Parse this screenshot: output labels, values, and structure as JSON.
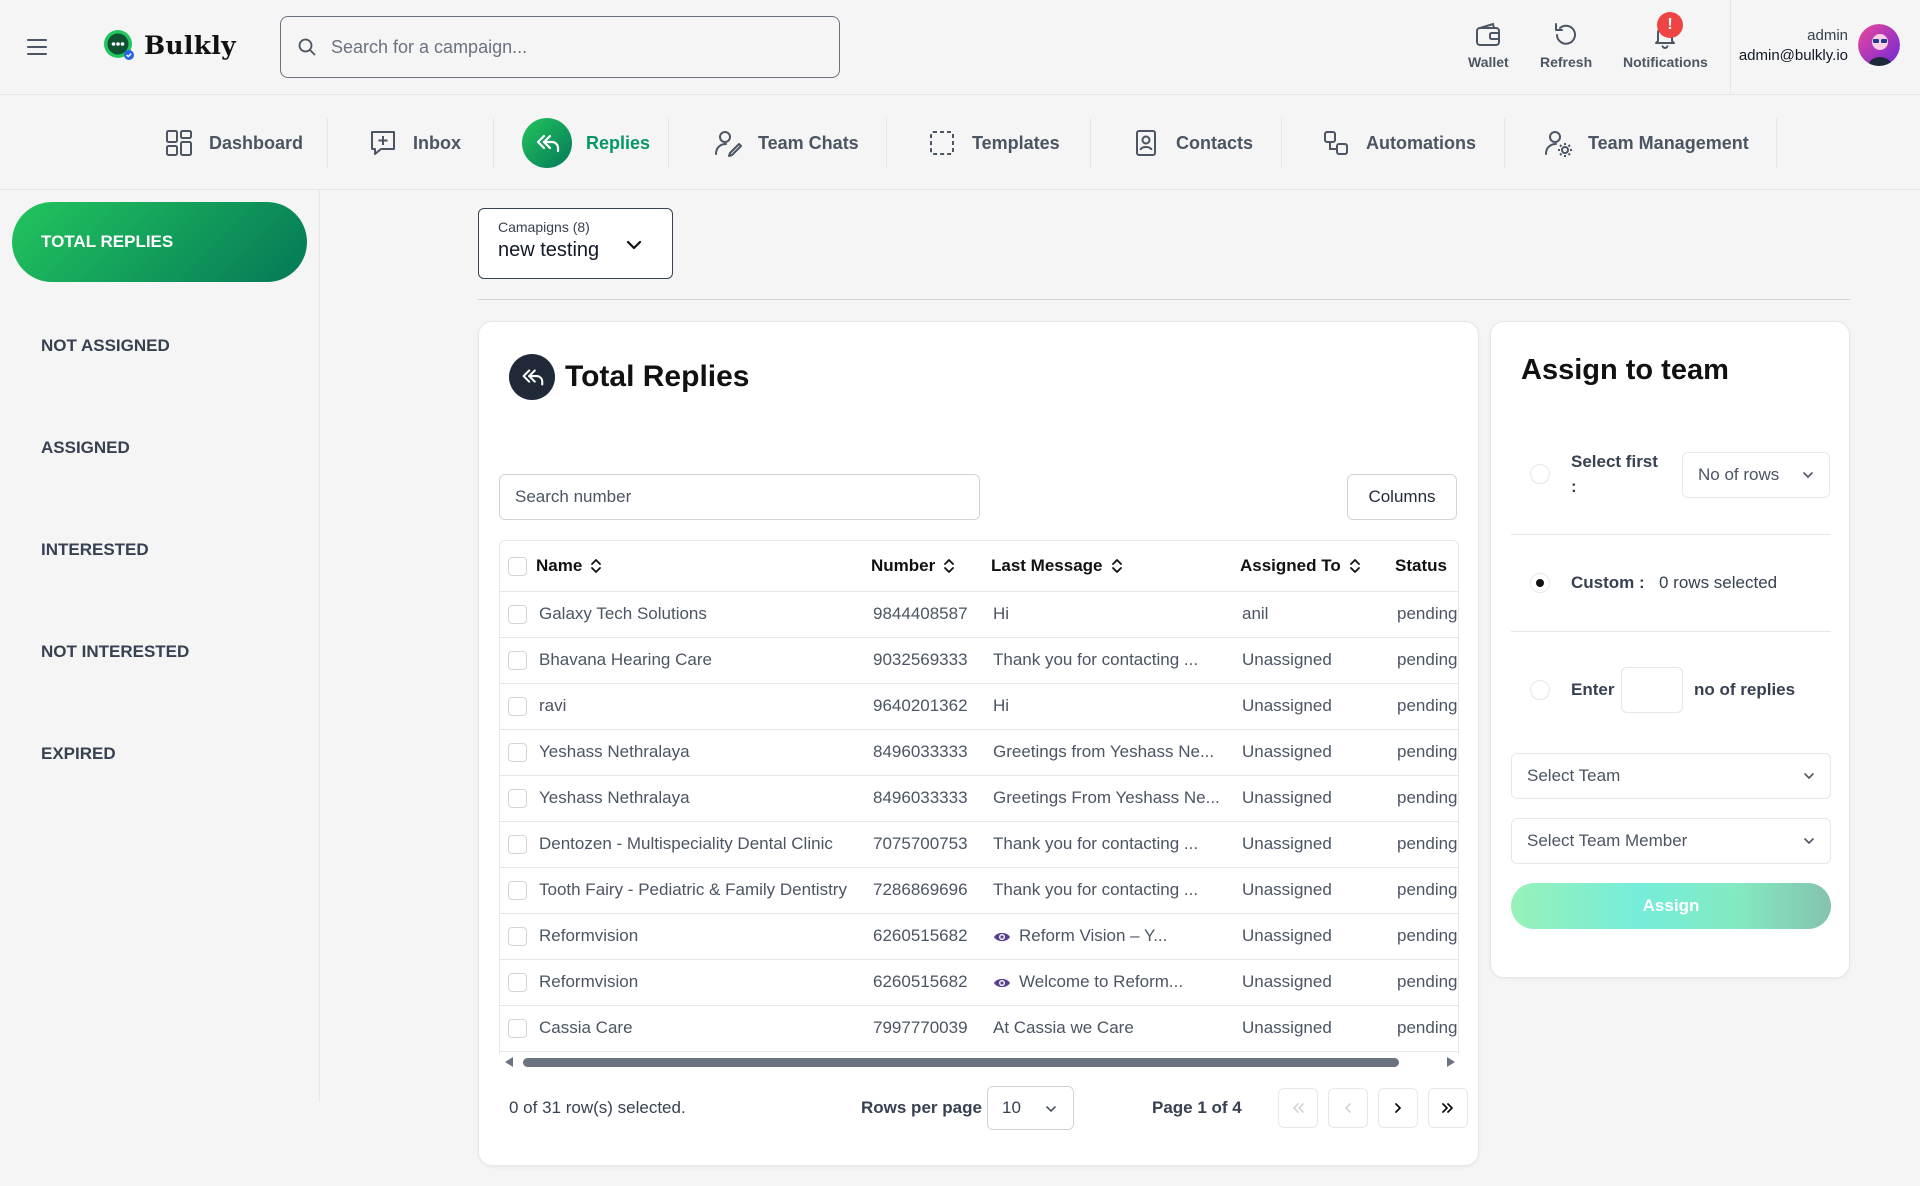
{
  "app": {
    "name": "Bulkly"
  },
  "header": {
    "search_placeholder": "Search for a campaign...",
    "wallet_label": "Wallet",
    "refresh_label": "Refresh",
    "notifications_label": "Notifications",
    "notifications_badge": "!",
    "user_name": "admin",
    "user_email": "admin@bulkly.io"
  },
  "nav": {
    "items": [
      {
        "label": "Dashboard",
        "icon": "dashboard-icon"
      },
      {
        "label": "Inbox",
        "icon": "inbox-icon"
      },
      {
        "label": "Replies",
        "icon": "replies-icon",
        "active": true
      },
      {
        "label": "Team Chats",
        "icon": "team-chats-icon"
      },
      {
        "label": "Templates",
        "icon": "templates-icon"
      },
      {
        "label": "Contacts",
        "icon": "contacts-icon"
      },
      {
        "label": "Automations",
        "icon": "automations-icon"
      },
      {
        "label": "Team Management",
        "icon": "team-management-icon"
      }
    ]
  },
  "sidebar": {
    "items": [
      {
        "label": "TOTAL REPLIES",
        "active": true
      },
      {
        "label": "NOT ASSIGNED"
      },
      {
        "label": "ASSIGNED"
      },
      {
        "label": "INTERESTED"
      },
      {
        "label": "NOT INTERESTED"
      },
      {
        "label": "EXPIRED"
      }
    ]
  },
  "campaign_select": {
    "label": "Camapigns (8)",
    "value": "new testing"
  },
  "main": {
    "title": "Total Replies",
    "search_placeholder": "Search number",
    "columns_label": "Columns",
    "table": {
      "headers": [
        "Name",
        "Number",
        "Last Message",
        "Assigned To",
        "Status"
      ],
      "rows": [
        {
          "name": "Galaxy Tech Solutions",
          "number": "9844408587",
          "message": "Hi",
          "eye": false,
          "assigned": "anil",
          "status": "pending"
        },
        {
          "name": "Bhavana Hearing Care",
          "number": "9032569333",
          "message": "Thank you for contacting ...",
          "eye": false,
          "assigned": "Unassigned",
          "status": "pending"
        },
        {
          "name": "ravi",
          "number": "9640201362",
          "message": "Hi",
          "eye": false,
          "assigned": "Unassigned",
          "status": "pending"
        },
        {
          "name": "Yeshass Nethralaya",
          "number": "8496033333",
          "message": "Greetings from Yeshass Ne...",
          "eye": false,
          "assigned": "Unassigned",
          "status": "pending"
        },
        {
          "name": "Yeshass Nethralaya",
          "number": "8496033333",
          "message": "Greetings From Yeshass Ne...",
          "eye": false,
          "assigned": "Unassigned",
          "status": "pending"
        },
        {
          "name": "Dentozen - Multispeciality Dental Clinic",
          "number": "7075700753",
          "message": "Thank you for contacting ...",
          "eye": false,
          "assigned": "Unassigned",
          "status": "pending"
        },
        {
          "name": "Tooth Fairy - Pediatric & Family Dentistry",
          "number": "7286869696",
          "message": "Thank you for contacting ...",
          "eye": false,
          "assigned": "Unassigned",
          "status": "pending"
        },
        {
          "name": "Reformvision",
          "number": "6260515682",
          "message": "Reform Vision – Y...",
          "eye": true,
          "assigned": "Unassigned",
          "status": "pending"
        },
        {
          "name": "Reformvision",
          "number": "6260515682",
          "message": "Welcome to Reform...",
          "eye": true,
          "assigned": "Unassigned",
          "status": "pending"
        },
        {
          "name": "Cassia Care",
          "number": "7997770039",
          "message": "At Cassia we Care",
          "eye": false,
          "assigned": "Unassigned",
          "status": "pending"
        }
      ]
    },
    "footer": {
      "selected_text": "0 of 31 row(s) selected.",
      "rows_per_page_label": "Rows per page",
      "rows_per_page_value": "10",
      "page_label": "Page 1 of 4"
    }
  },
  "assign": {
    "title": "Assign to team",
    "select_first_label": "Select first",
    "select_first_colon": ":",
    "no_of_rows_placeholder": "No of rows",
    "custom_label": "Custom :",
    "custom_value": "0 rows selected",
    "enter_label": "Enter",
    "no_of_replies_label": "no of replies",
    "select_team_placeholder": "Select Team",
    "select_member_placeholder": "Select Team Member",
    "assign_button": "Assign"
  },
  "colors": {
    "accent": "#059669",
    "accent_gradient_start": "#22c55e",
    "accent_gradient_end": "#047857"
  }
}
